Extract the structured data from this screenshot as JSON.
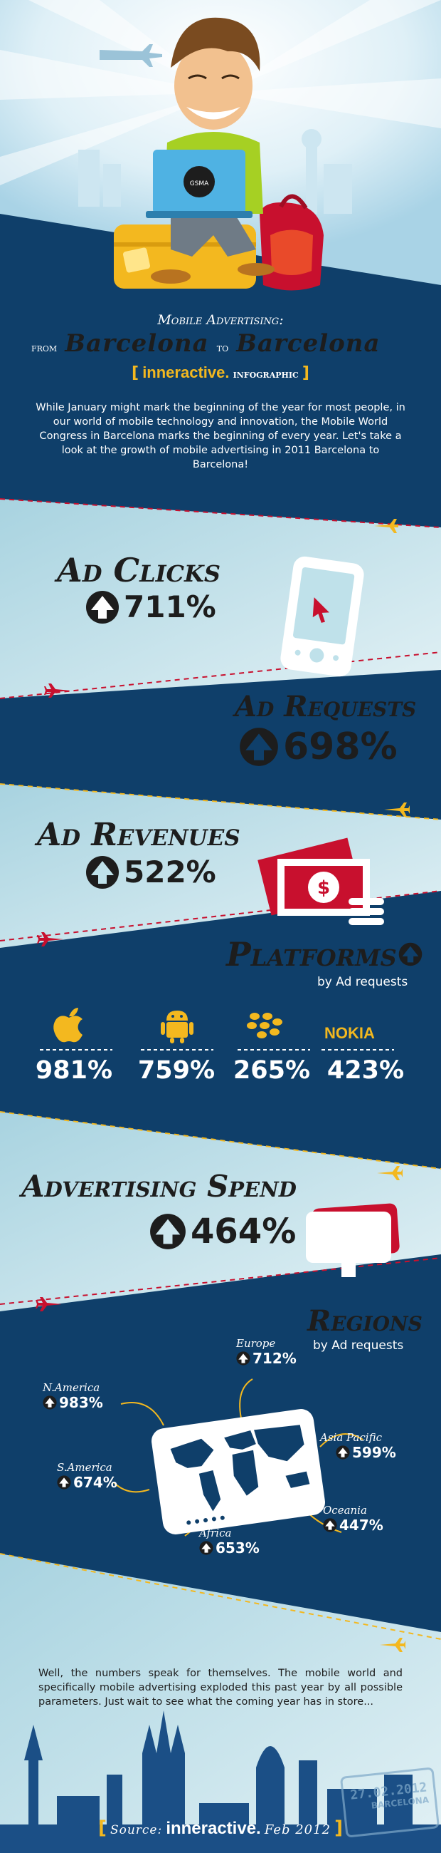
{
  "header": {
    "title_small": "Mobile Advertising:",
    "from": "from",
    "city1": "Barcelona",
    "to": "to",
    "city2": "Barcelona",
    "brand": "inneractive.",
    "infographic": "infographic",
    "bracket_open": "[",
    "bracket_close": "]",
    "laptop_badge": "GSMA"
  },
  "intro": "While January might mark the beginning of the year for most people, in our world of mobile technology and innovation, the Mobile World Congress in Barcelona marks the beginning of every year. Let's take a look at the growth of mobile advertising in 2011 Barcelona to Barcelona!",
  "stats": {
    "ad_clicks": {
      "label": "Ad Clicks",
      "value": "711%"
    },
    "ad_requests": {
      "label": "Ad Requests",
      "value": "698%"
    },
    "ad_revenues": {
      "label": "Ad Revenues",
      "value": "522%"
    },
    "ad_spend": {
      "label": "Advertising Spend",
      "value": "464%"
    }
  },
  "platforms": {
    "title": "Platforms",
    "subtitle": "by Ad requests",
    "items": [
      {
        "icon": "apple-icon",
        "value": "981%"
      },
      {
        "icon": "android-icon",
        "value": "759%"
      },
      {
        "icon": "blackberry-icon",
        "value": "265%"
      },
      {
        "icon": "nokia-logo",
        "name": "NOKIA",
        "value": "423%"
      }
    ]
  },
  "regions": {
    "title": "Regions",
    "subtitle": "by Ad requests",
    "items": [
      {
        "name": "Europe",
        "value": "712%"
      },
      {
        "name": "N.America",
        "value": "983%"
      },
      {
        "name": "Asia Pacific",
        "value": "599%"
      },
      {
        "name": "S.America",
        "value": "674%"
      },
      {
        "name": "Oceania",
        "value": "447%"
      },
      {
        "name": "Africa",
        "value": "653%"
      }
    ]
  },
  "outro": "Well, the numbers speak for themselves. The mobile world and specifically mobile advertising exploded this past year by all possible parameters. Just wait to see what the coming year has in store...",
  "stamp": {
    "date": "27.02.2012",
    "city": "BARCELONA"
  },
  "footer": {
    "bracket_open": "[",
    "source": "Source:",
    "brand": "inneractive.",
    "date": "Feb 2012",
    "bracket_close": "]"
  },
  "colors": {
    "navy": "#0f3f6a",
    "light_blue": "#bfe1ea",
    "yellow": "#f3b81f",
    "red": "#c8102e",
    "dark_text": "#1d1d1d"
  }
}
